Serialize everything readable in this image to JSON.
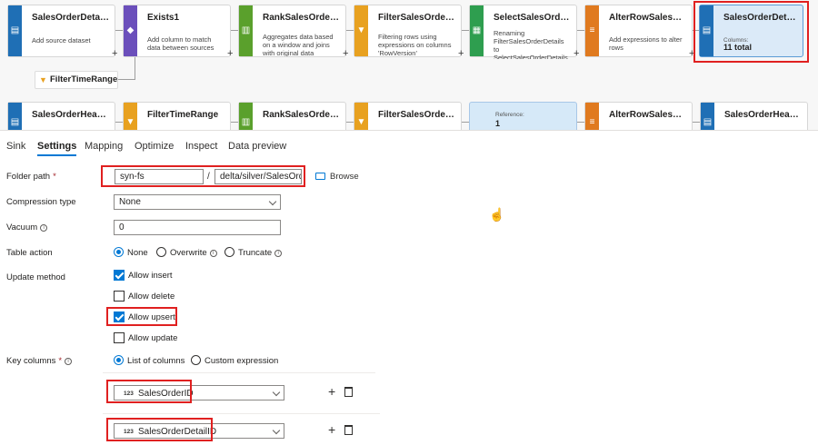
{
  "canvas": {
    "row1": [
      {
        "title": "SalesOrderDetail...",
        "desc": "Add source dataset",
        "color": "#1f6fb5",
        "icon": "source-icon"
      },
      {
        "title": "Exists1",
        "desc": "Add column to match data between sources",
        "color": "#6b4fbb",
        "icon": "exists-icon"
      },
      {
        "title": "RankSalesOrderDet...",
        "desc": "Aggregates data based on a window and joins with original data",
        "color": "#5aa02c",
        "icon": "window-icon"
      },
      {
        "title": "FilterSalesOrderDet...",
        "desc": "Filtering rows using expressions on columns 'RowVersion'",
        "color": "#e8a120",
        "icon": "filter-icon"
      },
      {
        "title": "SelectSalesOrderDe...",
        "desc": "Renaming FilterSalesOrderDetails to SelectSalesOrderDetails with columns",
        "color": "#2e9e4f",
        "icon": "select-icon"
      },
      {
        "title": "AlterRowSalesOrde...",
        "desc": "Add expressions to alter rows",
        "color": "#e07a1f",
        "icon": "alter-row-icon"
      },
      {
        "title": "SalesOrderDetail...",
        "desc": "Columns:",
        "count": "11 total",
        "color": "#1f6fb5",
        "icon": "sink-icon"
      }
    ],
    "filter_chip": "FilterTimeRange",
    "row2": [
      {
        "title": "SalesOrderHeade...",
        "color": "#1f6fb5"
      },
      {
        "title": "FilterTimeRange",
        "color": "#e8a120"
      },
      {
        "title": "RankSalesOrderHe...",
        "color": "#5aa02c"
      },
      {
        "title": "FilterSalesOrderHe...",
        "color": "#e8a120"
      },
      {
        "title": "Reference:",
        "count": "1",
        "color": "#a7c7e7"
      },
      {
        "title": "AlterRowSalesOrde...",
        "color": "#e07a1f"
      },
      {
        "title": "SalesOrderHeade...",
        "color": "#1f6fb5"
      }
    ]
  },
  "tabs": [
    "Sink",
    "Settings",
    "Mapping",
    "Optimize",
    "Inspect",
    "Data preview"
  ],
  "form": {
    "folder_path_label": "Folder path",
    "required_mark": "*",
    "folder_path_container": "syn-fs",
    "folder_sep": "/",
    "folder_path_dir": "delta/silver/SalesOrde",
    "browse_label": "Browse",
    "compression_label": "Compression type",
    "compression_value": "None",
    "vacuum_label": "Vacuum",
    "vacuum_value": "0",
    "table_action_label": "Table action",
    "table_action_options": [
      "None",
      "Overwrite",
      "Truncate"
    ],
    "update_method_label": "Update method",
    "update_options": [
      {
        "label": "Allow insert",
        "checked": true
      },
      {
        "label": "Allow delete",
        "checked": false
      },
      {
        "label": "Allow upsert",
        "checked": true
      },
      {
        "label": "Allow update",
        "checked": false
      }
    ],
    "key_columns_label": "Key columns",
    "key_mode_options": [
      "List of columns",
      "Custom expression"
    ],
    "key_columns": [
      "SalesOrderID",
      "SalesOrderDetailID"
    ],
    "type_badge": "123",
    "info_glyph": "i"
  }
}
